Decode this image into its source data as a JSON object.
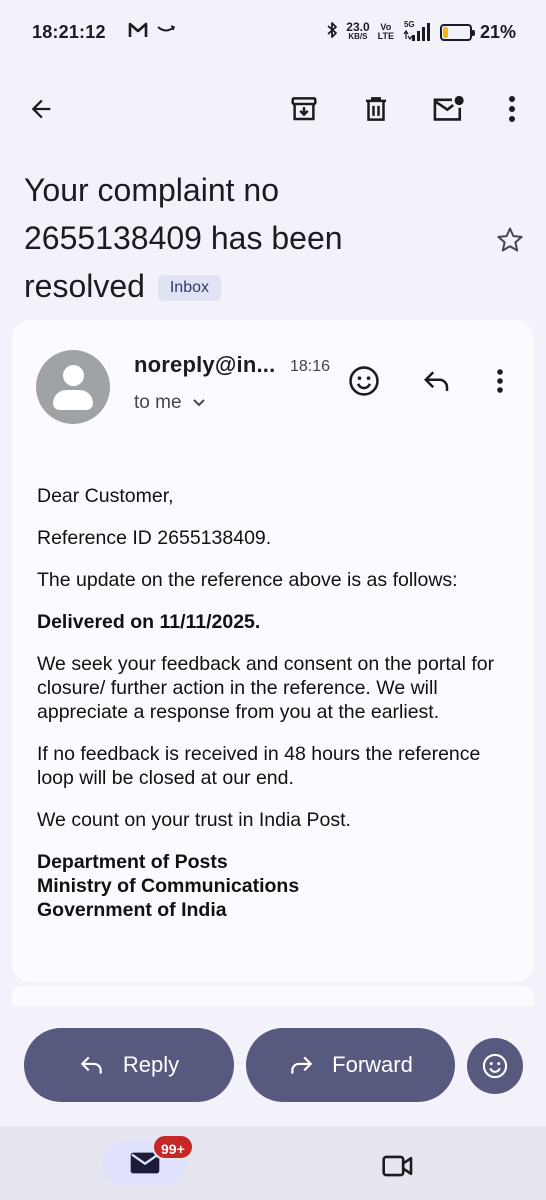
{
  "status_bar": {
    "time": "18:21:12",
    "net_speed_value": "23.0",
    "net_speed_unit": "KB/S",
    "volte_top": "Vo",
    "volte_bottom": "LTE",
    "network": "5G",
    "battery_percent": "21%",
    "battery_level": 0.21,
    "battery_color": "#f6b70c"
  },
  "toolbar": {
    "back_icon": "arrow-back-icon",
    "archive_icon": "archive-icon",
    "delete_icon": "trash-icon",
    "mark_unread_icon": "mail-unread-icon",
    "more_icon": "more-vert-icon"
  },
  "email": {
    "subject": "Your complaint no 2655138409 has been resolved",
    "label": "Inbox",
    "starred": false,
    "sender": "noreply@in...",
    "time": "18:16",
    "recipient": "to me",
    "greeting": "Dear Customer,",
    "reference_line": "Reference ID 2655138409.",
    "update_intro": "The update on the reference above is as follows:",
    "status_line": "Delivered on 11/11/2025.",
    "feedback_request": "We seek your feedback and consent on the portal for closure/ further action in the reference. We will appreciate a response from you at the earliest.",
    "auto_close_note": "If no feedback is received in 48 hours the reference loop will be closed at our end.",
    "trust_line": "We count on your trust in India Post.",
    "signature": {
      "line1": "Department of Posts",
      "line2": "Ministry of Communications",
      "line3": "Government of India"
    }
  },
  "actions": {
    "reply_label": "Reply",
    "forward_label": "Forward",
    "accent_color": "#575a7e"
  },
  "bottom_nav": {
    "mail_badge": "99+",
    "badge_color": "#c62828"
  }
}
